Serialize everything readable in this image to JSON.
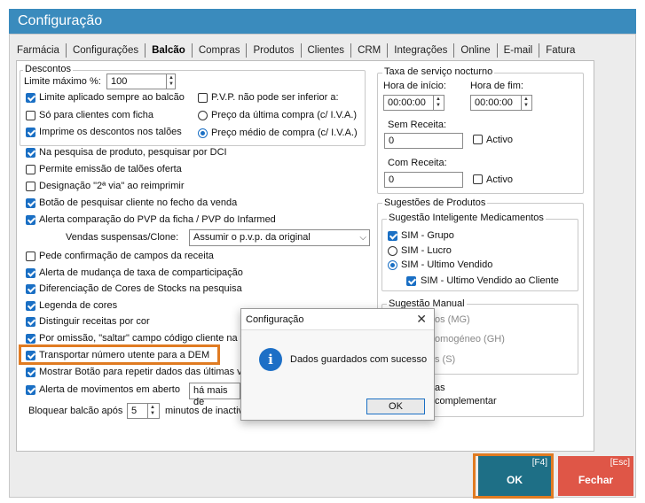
{
  "window": {
    "title": "Configuração"
  },
  "tabs": [
    "Farmácia",
    "Configurações",
    "Balcão",
    "Compras",
    "Produtos",
    "Clientes",
    "CRM",
    "Integrações",
    "Online",
    "E-mail",
    "Fatura"
  ],
  "active_tab": "Balcão",
  "descontos": {
    "group_label": "Descontos",
    "limite_label": "Limite máximo %:",
    "limite_value": "100",
    "limite_sempre": "Limite aplicado sempre ao balcão",
    "so_clientes": "Só para clientes com ficha",
    "imprime": "Imprime os descontos nos talões",
    "pvp_inferior": "P.V.P. não pode ser inferior a:",
    "preco_ultima": "Preço da última compra (c/ I.V.A.)",
    "preco_medio": "Preço médio de compra (c/ I.V.A.)"
  },
  "options": {
    "dci": "Na pesquisa de produto, pesquisar por DCI",
    "permite_emissao": "Permite emissão de talões oferta",
    "designacao": "Designação \"2ª via\" ao reimprimir",
    "botao_pesquisar": "Botão de pesquisar cliente no fecho da venda",
    "alerta_pvp": "Alerta comparação do PVP da ficha / PVP do Infarmed",
    "vendas_label": "Vendas suspensas/Clone:",
    "vendas_value": "Assumir o p.v.p. da original",
    "pede_confirmacao": "Pede confirmação de campos da receita",
    "alerta_taxa": "Alerta de mudança de taxa de comparticipação",
    "diferenciacao": "Diferenciação de Cores de Stocks na pesquisa",
    "legenda": "Legenda de cores",
    "distinguir": "Distinguir receitas por cor",
    "por_omissao": "Por omissão, \"saltar\" campo código cliente na v",
    "transportar": "Transportar número utente para a DEM",
    "mostrar_botao": "Mostrar Botão para repetir dados das últimas v",
    "alerta_movimentos": "Alerta de movimentos em aberto",
    "alerta_mov_value": "há mais de",
    "bloquear_label": "Bloquear balcão após",
    "bloquear_value": "5",
    "bloquear_suffix": "minutos de inactiv"
  },
  "taxa": {
    "group_label": "Taxa de serviço nocturno",
    "hora_inicio_label": "Hora de início:",
    "hora_inicio": "00:00:00",
    "hora_fim_label": "Hora de fim:",
    "hora_fim": "00:00:00",
    "sem_receita_label": "Sem Receita:",
    "sem_receita_value": "0",
    "com_receita_label": "Com Receita:",
    "com_receita_value": "0",
    "activo": "Activo"
  },
  "sugestoes": {
    "group_label": "Sugestões de Produtos",
    "inteligente_label": "Sugestão Inteligente Medicamentos",
    "sim_grupo": "SIM - Grupo",
    "sim_lucro": "SIM - Lucro",
    "sim_ultimo": "SIM - Ultimo Vendido",
    "sim_ultimo_cliente": "SIM - Ultimo Vendido ao Cliente",
    "manual_label": "Sugestão Manual",
    "manual_1": "os (MG)",
    "manual_2": "omogéneo (GH)",
    "manual_3": "s (S)",
    "extra_1": "as",
    "extra_2": "complementar"
  },
  "dialog": {
    "title": "Configuração",
    "message": "Dados guardados com sucesso",
    "ok": "OK"
  },
  "buttons": {
    "ok_label": "OK",
    "ok_hotkey": "[F4]",
    "fechar_label": "Fechar",
    "fechar_hotkey": "[Esc]"
  },
  "colors": {
    "titlebar": "#3a8bbd",
    "ok_button": "#1e6f86",
    "fechar_button": "#df5647",
    "highlight": "#e07b22",
    "checkbox": "#1a6fc4"
  }
}
